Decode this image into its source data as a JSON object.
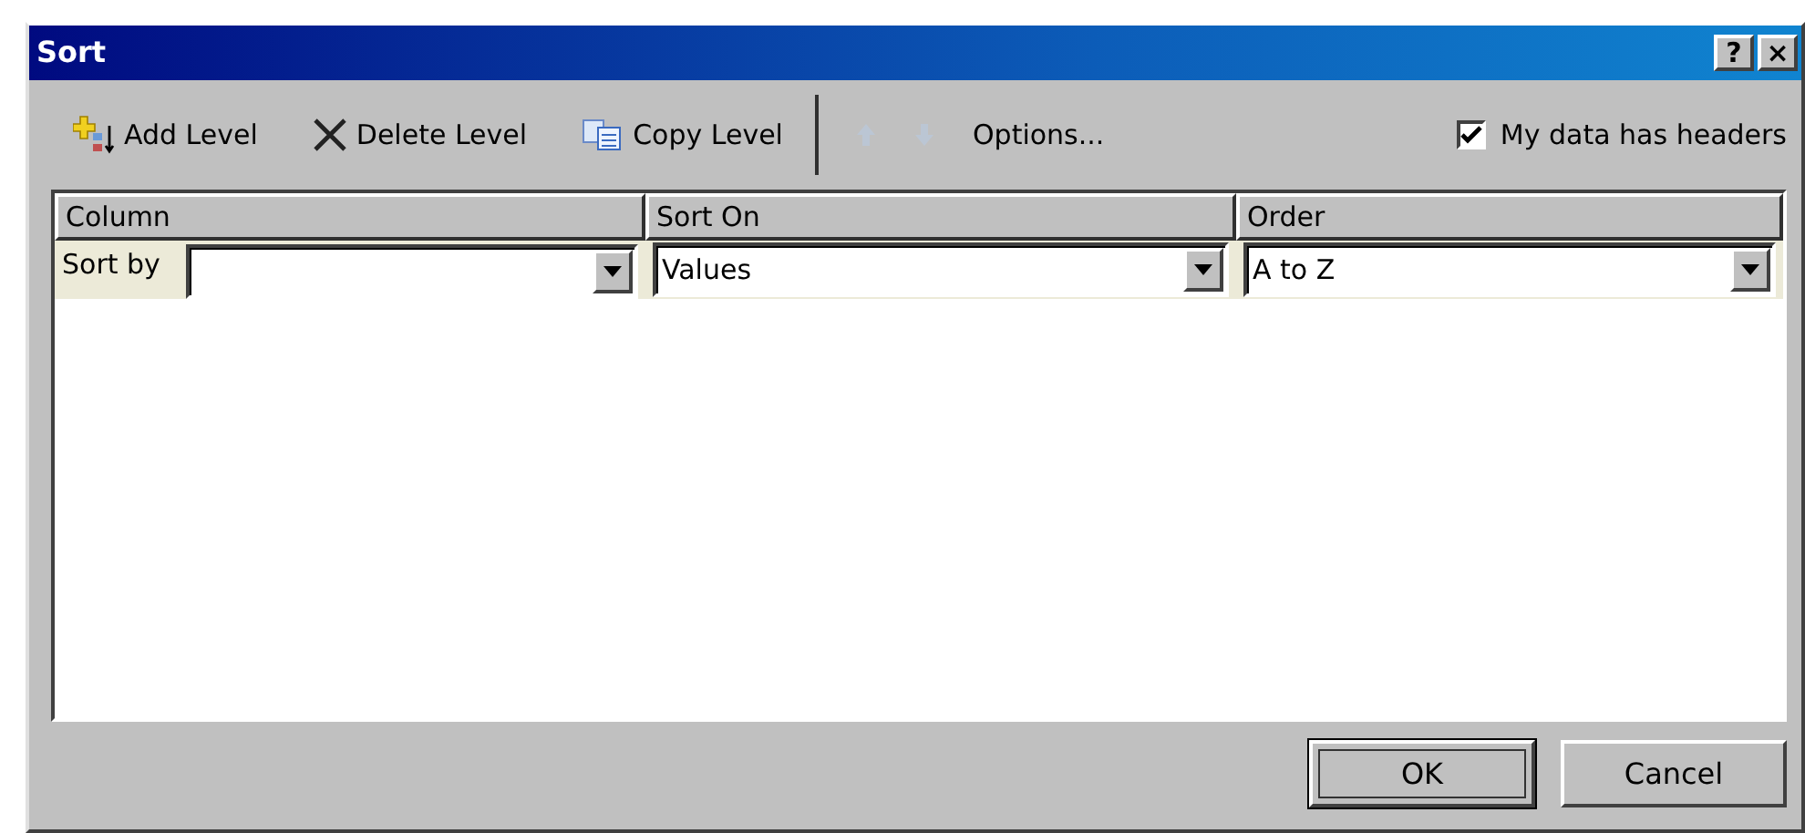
{
  "window": {
    "title": "Sort",
    "title_buttons": [
      "?",
      "×"
    ]
  },
  "toolbar": [
    {
      "kind": "add",
      "label": "Add Level"
    },
    {
      "kind": "delete",
      "label": "Delete Level"
    },
    {
      "kind": "copy",
      "label": "Copy Level"
    },
    {
      "kind": "separator"
    },
    {
      "kind": "up",
      "disabled": true
    },
    {
      "kind": "down",
      "disabled": true
    },
    {
      "kind": "text",
      "label": "Options..."
    }
  ],
  "headers_checkbox": {
    "label": "My data has headers",
    "checked": true
  },
  "grid": {
    "columns": [
      "Column",
      "Sort On",
      "Order"
    ],
    "rows": [
      {
        "label": "Sort by",
        "column": "",
        "sort_on": "Values",
        "order": "A to Z"
      }
    ]
  },
  "buttons": [
    {
      "label": "OK",
      "default": true
    },
    {
      "label": "Cancel",
      "default": false
    }
  ]
}
